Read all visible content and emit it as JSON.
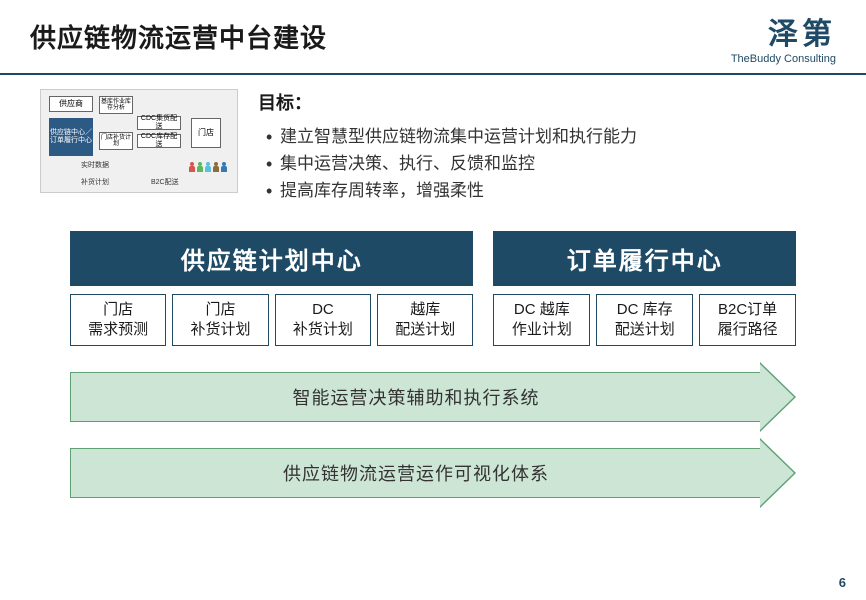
{
  "header": {
    "title": "供应链物流运营中台建设",
    "logo_cn": "泽第",
    "logo_en": "TheBuddy Consulting"
  },
  "mini_diagram": {
    "supplier": "供应商",
    "center": "供应链中心／订单履行中心",
    "sk1": "基库作业库存分析",
    "sk2": "门店补货计划",
    "cdc1": "CDC集货配送",
    "cdc2": "CDC库存配送",
    "store": "门店",
    "label1": "实时数据",
    "label2": "补货计划",
    "label3": "B2C配送"
  },
  "goals": {
    "heading": "目标：",
    "items": [
      "建立智慧型供应链物流集中运营计划和执行能力",
      "集中运营决策、执行、反馈和监控",
      "提高库存周转率，增强柔性"
    ]
  },
  "centers": {
    "left": "供应链计划中心",
    "right": "订单履行中心"
  },
  "left_items": [
    "门店\n需求预测",
    "门店\n补货计划",
    "DC\n补货计划",
    "越库\n配送计划"
  ],
  "right_items": [
    "DC 越库\n作业计划",
    "DC 库存\n配送计划",
    "B2C订单\n履行路径"
  ],
  "arrows": {
    "arrow1": "智能运营决策辅助和执行系统",
    "arrow2": "供应链物流运营运作可视化体系"
  },
  "page_number": "6"
}
